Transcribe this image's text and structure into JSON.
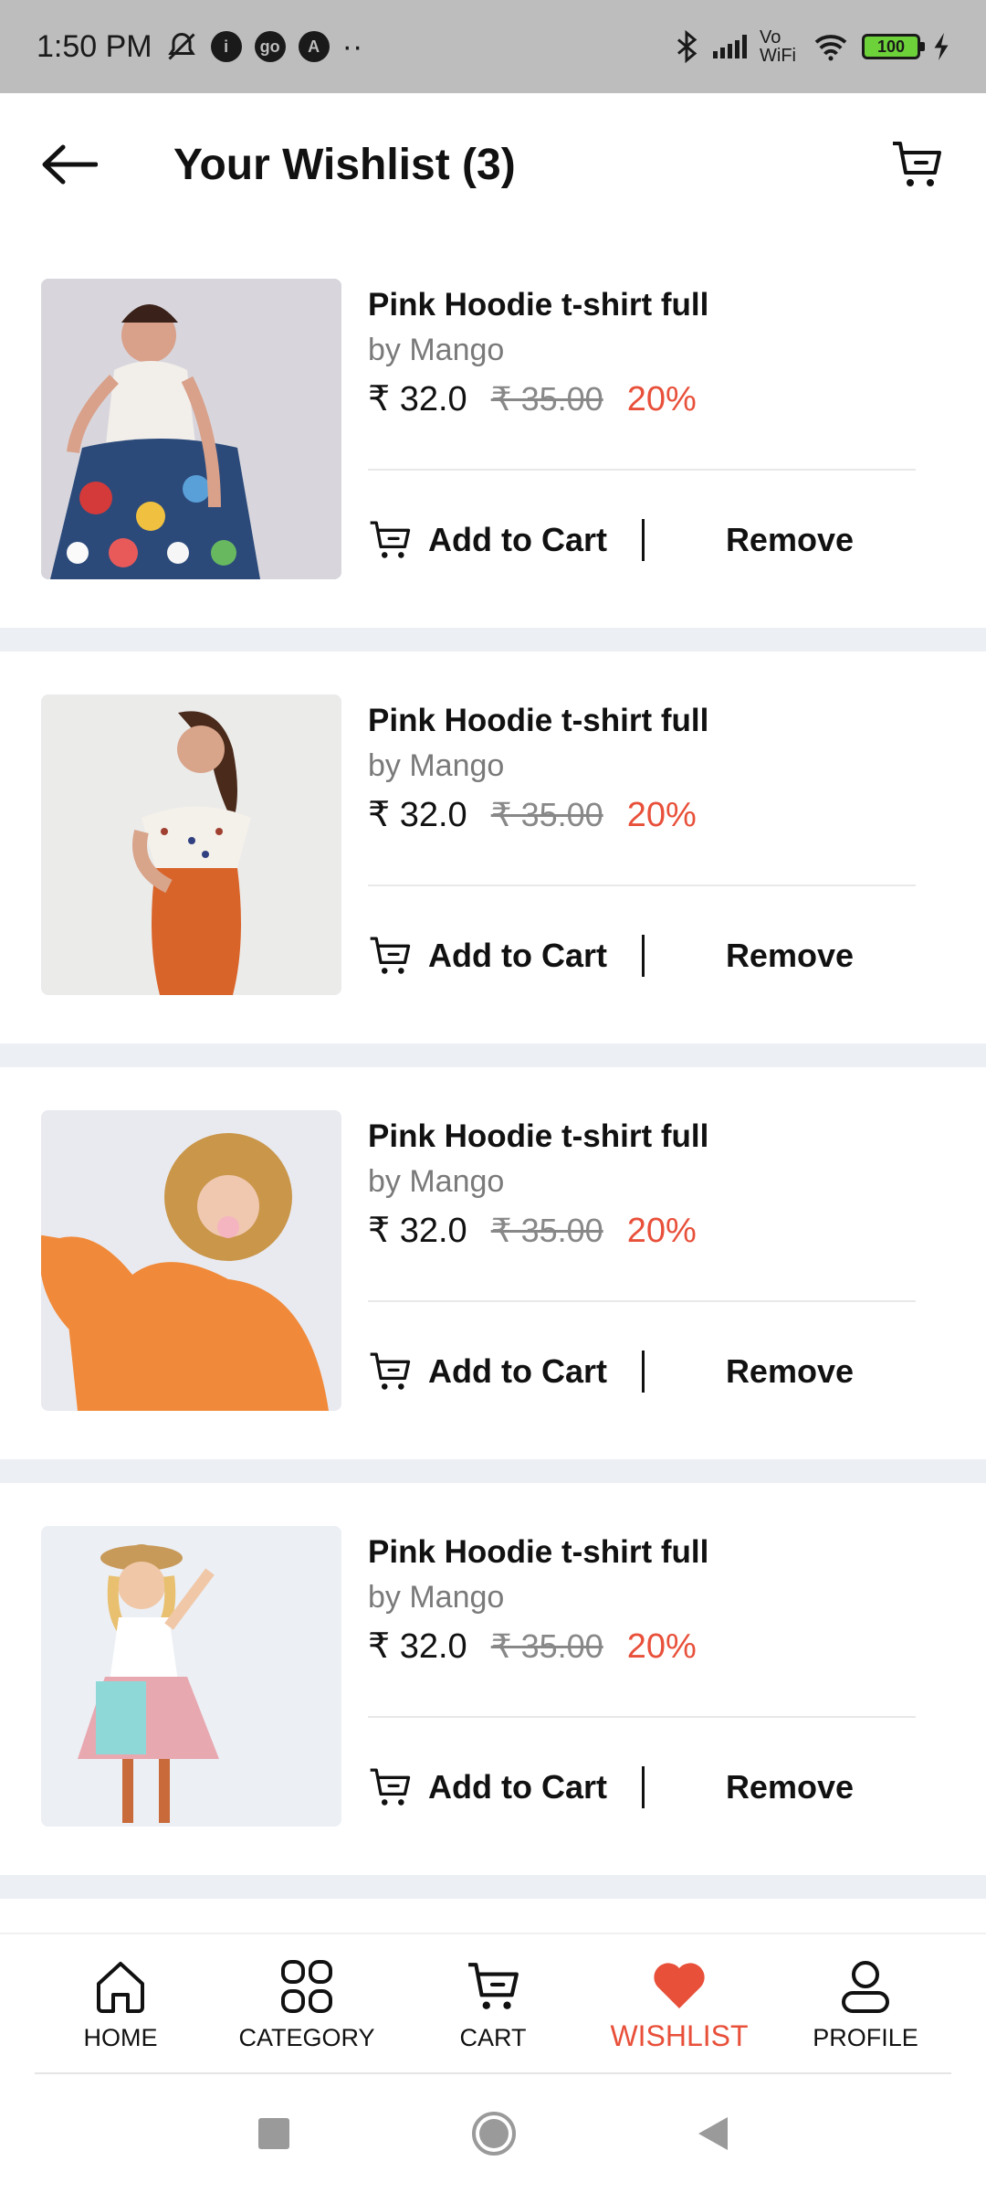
{
  "status_bar": {
    "time": "1:50 PM",
    "icons": [
      "mute-icon",
      "app-icon",
      "go-icon",
      "a-icon"
    ],
    "more": "··",
    "network_label": "Vo WiFi",
    "battery": "100"
  },
  "header": {
    "title": "Your Wishlist (3)"
  },
  "items": [
    {
      "name": "Pink Hoodie t-shirt full",
      "brand": "by Mango",
      "price": "₹ 32.0",
      "old_price": "₹ 35.00",
      "discount": "20%",
      "add_label": "Add to Cart",
      "remove_label": "Remove"
    },
    {
      "name": "Pink Hoodie t-shirt full",
      "brand": "by Mango",
      "price": "₹ 32.0",
      "old_price": "₹ 35.00",
      "discount": "20%",
      "add_label": "Add to Cart",
      "remove_label": "Remove"
    },
    {
      "name": "Pink Hoodie t-shirt full",
      "brand": "by Mango",
      "price": "₹ 32.0",
      "old_price": "₹ 35.00",
      "discount": "20%",
      "add_label": "Add to Cart",
      "remove_label": "Remove"
    },
    {
      "name": "Pink Hoodie t-shirt full",
      "brand": "by Mango",
      "price": "₹ 32.0",
      "old_price": "₹ 35.00",
      "discount": "20%",
      "add_label": "Add to Cart",
      "remove_label": "Remove"
    }
  ],
  "bottom_nav": [
    {
      "label": "HOME",
      "icon": "home-icon"
    },
    {
      "label": "CATEGORY",
      "icon": "category-icon"
    },
    {
      "label": "CART",
      "icon": "cart-icon"
    },
    {
      "label": "WISHLIST",
      "icon": "heart-icon",
      "active": true
    },
    {
      "label": "PROFILE",
      "icon": "profile-icon"
    }
  ],
  "colors": {
    "accent": "#e8503a",
    "discount": "#e8503a",
    "separator": "#eceff4",
    "status_bar": "#bdbdbd"
  }
}
